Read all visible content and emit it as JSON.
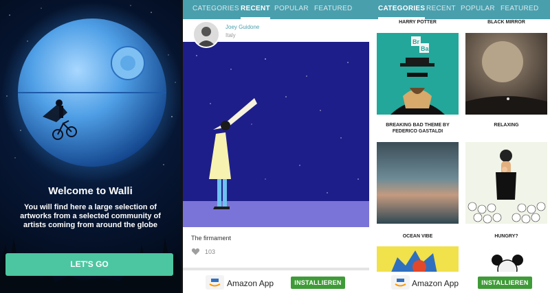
{
  "welcome": {
    "title": "Welcome to Walli",
    "body": "You will find here a large selection of artworks from a selected community of artists coming from around the globe",
    "button_label": "LET'S GO"
  },
  "tabs": {
    "categories": "CATEGORIES",
    "recent": "RECENT",
    "popular": "POPULAR",
    "featured": "FEATURED"
  },
  "recent": {
    "author_name": "Joey Guidone",
    "author_location": "Italy",
    "artwork_title": "The firmament",
    "likes": "103"
  },
  "categories": {
    "items": [
      {
        "label": "HARRY POTTER"
      },
      {
        "label": "BLACK MIRROR"
      },
      {
        "label": "BREAKING BAD THEME BY FEDERICO GASTALDI"
      },
      {
        "label": "RELAXING"
      },
      {
        "label": "OCEAN VIBE"
      },
      {
        "label": "HUNGRY?"
      }
    ],
    "breaking_bad_symbols": {
      "br": "Br",
      "ba": "Ba"
    }
  },
  "ad": {
    "app_name": "Amazon App",
    "install_label": "INSTALLIEREN"
  },
  "colors": {
    "teal_tab": "#4a9fad",
    "button_green": "#4cc6a0",
    "install_green": "#3f9b37",
    "night_blue": "#1e1e8a"
  }
}
